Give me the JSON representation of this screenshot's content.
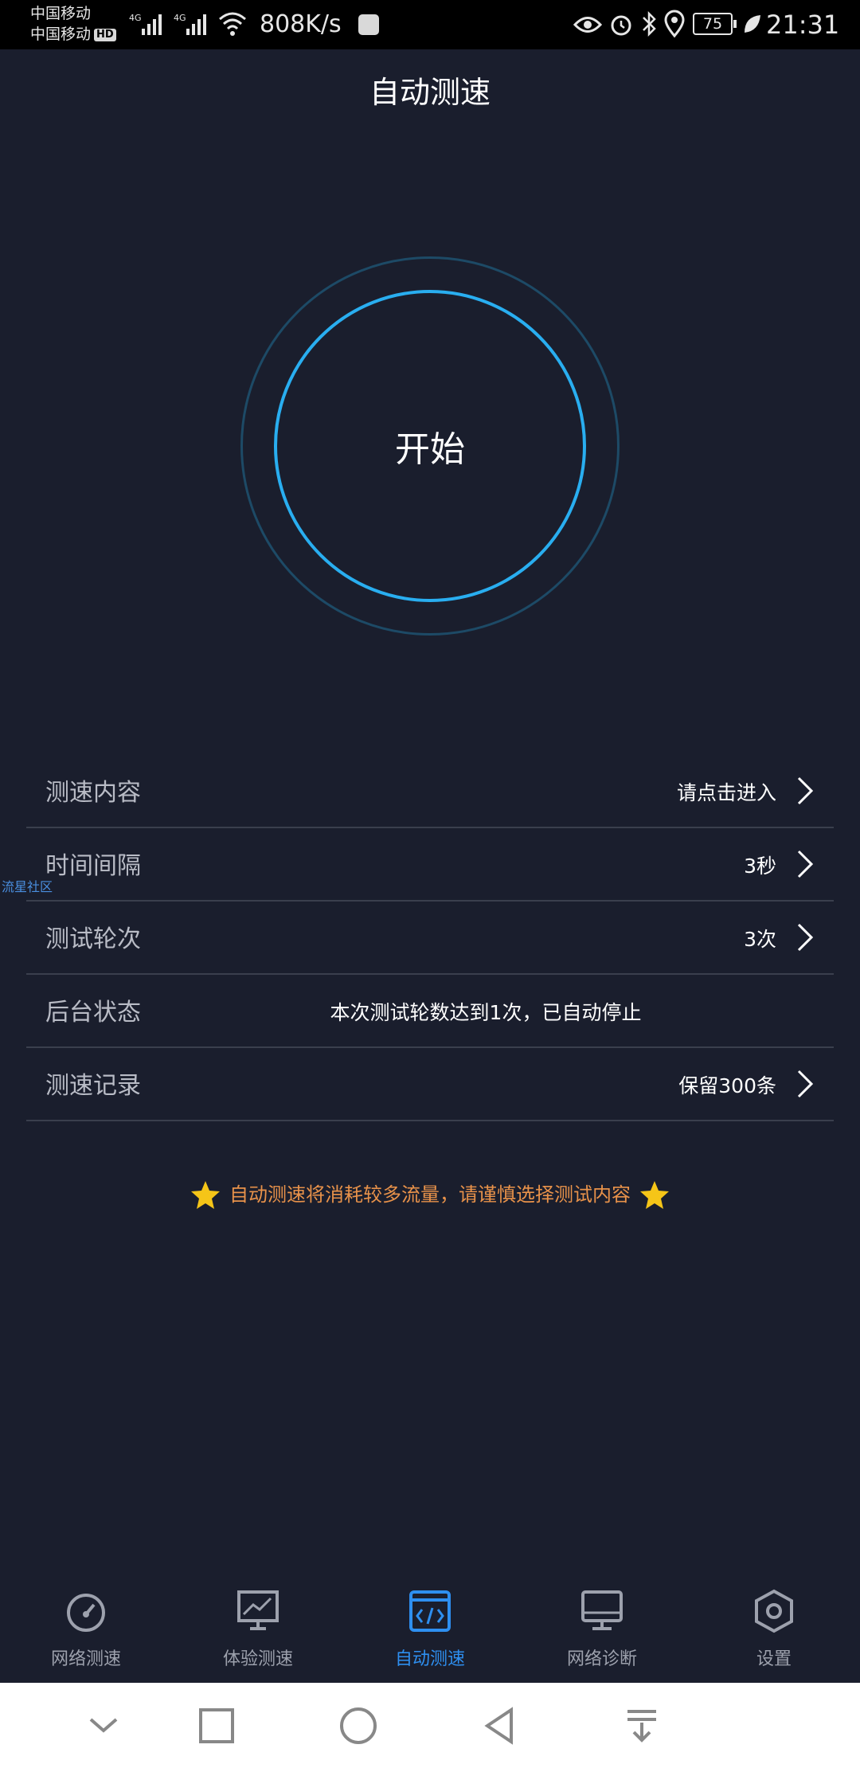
{
  "status_bar": {
    "carrier_1": "中国移动",
    "carrier_2": "中国移动",
    "hd_badge": "HD",
    "network_1": "4G",
    "network_2": "4G",
    "net_speed": "808K/s",
    "battery": "75",
    "time": "21:31"
  },
  "header": {
    "title": "自动测速"
  },
  "start_button": {
    "label": "开始"
  },
  "settings_rows": [
    {
      "label": "测速内容",
      "value": "请点击进入"
    },
    {
      "label": "时间间隔",
      "value": "3秒"
    },
    {
      "label": "测试轮次",
      "value": "3次"
    },
    {
      "label": "后台状态",
      "value": "本次测试轮数达到1次，已自动停止"
    },
    {
      "label": "测速记录",
      "value": "保留300条"
    }
  ],
  "side_label": "流星社区",
  "notice": "自动测速将消耗较多流量，请谨慎选择测试内容",
  "tabs": [
    {
      "label": "网络测速",
      "icon": "speedometer-icon"
    },
    {
      "label": "体验测速",
      "icon": "chart-monitor-icon"
    },
    {
      "label": "自动测速",
      "icon": "code-window-icon"
    },
    {
      "label": "网络诊断",
      "icon": "desktop-icon"
    },
    {
      "label": "设置",
      "icon": "hexagon-settings-icon"
    }
  ],
  "colors": {
    "background": "#1a1e2d",
    "accent": "#29aef0",
    "active_tab": "#2e8ff0",
    "notice": "#e8924a",
    "star": "#f5c518"
  }
}
